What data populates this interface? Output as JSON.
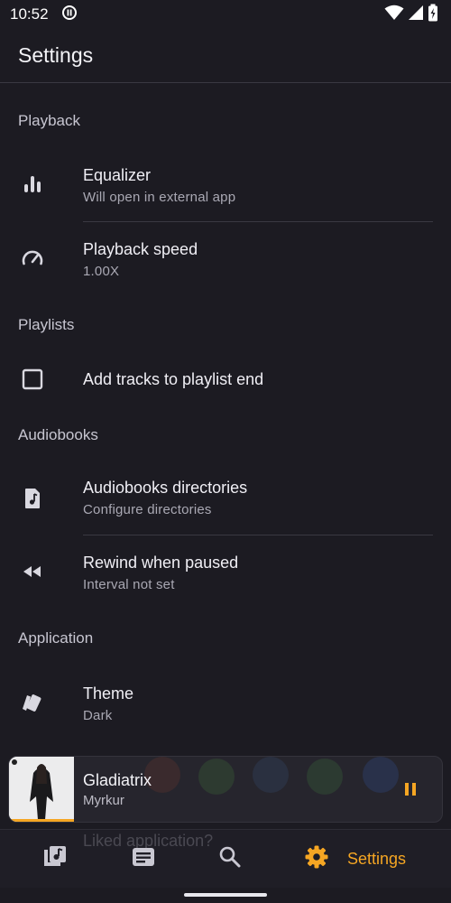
{
  "status_bar": {
    "time": "10:52"
  },
  "app_bar": {
    "title": "Settings"
  },
  "sections": {
    "playback": "Playback",
    "playlists": "Playlists",
    "audiobooks": "Audiobooks",
    "application": "Application"
  },
  "items": {
    "equalizer": {
      "title": "Equalizer",
      "subtitle": "Will open in external app"
    },
    "playback_speed": {
      "title": "Playback speed",
      "subtitle": "1.00X"
    },
    "add_tracks": {
      "title": "Add tracks to playlist end",
      "checked": false
    },
    "audiobook_dirs": {
      "title": "Audiobooks directories",
      "subtitle": "Configure directories"
    },
    "rewind": {
      "title": "Rewind when paused",
      "subtitle": "Interval not set"
    },
    "theme": {
      "title": "Theme",
      "subtitle": "Dark"
    }
  },
  "mini_player": {
    "title": "Gladiatrix",
    "artist": "Myrkur",
    "progress": 1.0,
    "accent": "#f5a623"
  },
  "bottom_nav": {
    "ghost_text": "Liked application?",
    "active_label": "Settings",
    "items": [
      "library-icon",
      "playlists-icon",
      "search-icon",
      "settings-icon"
    ]
  },
  "colors": {
    "background": "#1c1b22",
    "accent": "#f5a623",
    "text_secondary": "#a9a8b3"
  }
}
